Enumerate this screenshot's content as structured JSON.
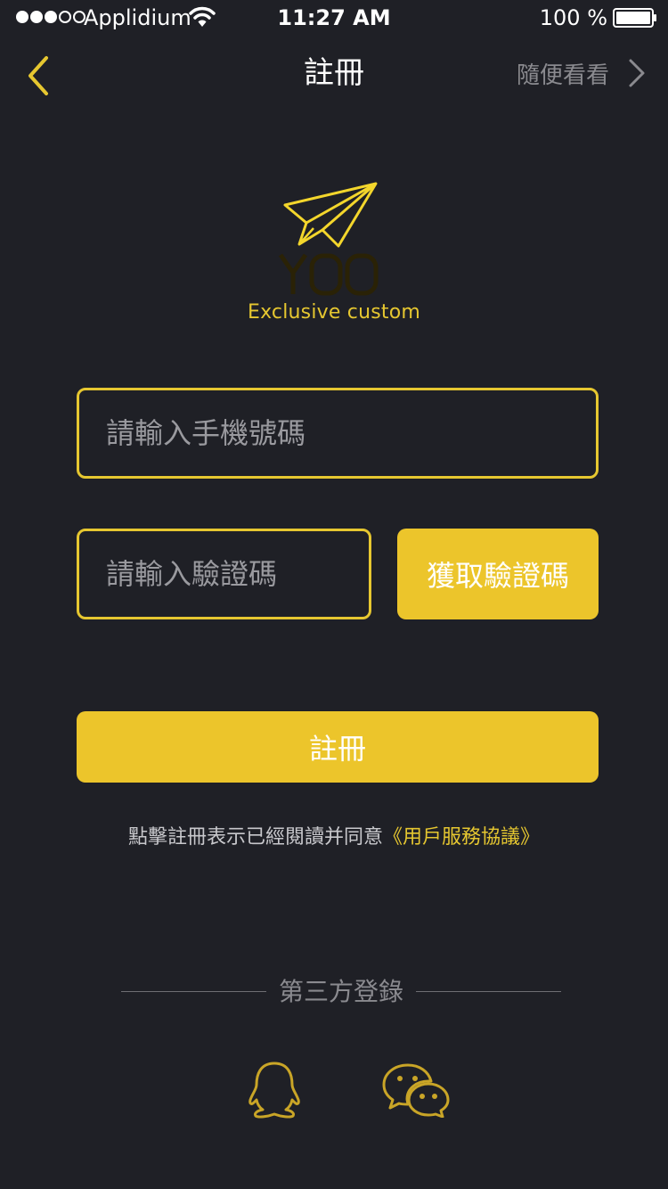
{
  "status_bar": {
    "carrier": "Applidium",
    "time": "11:27 AM",
    "battery": "100 %"
  },
  "nav": {
    "title": "註冊",
    "skip_label": "隨便看看"
  },
  "logo": {
    "wordmark": "YOO",
    "tagline": "Exclusive custom"
  },
  "form": {
    "phone_placeholder": "請輸入手機號碼",
    "code_placeholder": "請輸入驗證碼",
    "get_code_label": "獲取驗證碼",
    "register_label": "註冊"
  },
  "agreement": {
    "text": "點擊註冊表示已經閱讀并同意",
    "link": "《用戶服務協議》"
  },
  "third_party": {
    "label": "第三方登錄"
  },
  "colors": {
    "background": "#1f2026",
    "accent": "#ecc52b"
  }
}
